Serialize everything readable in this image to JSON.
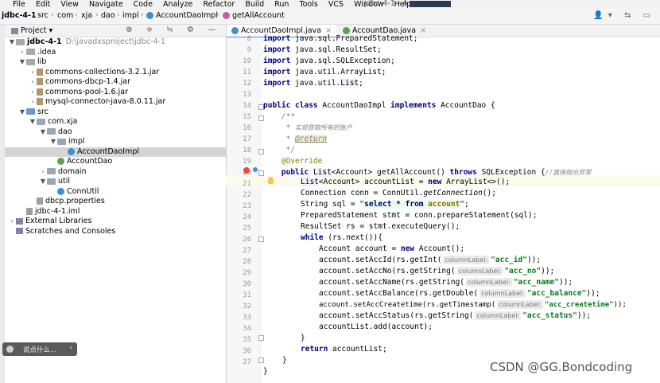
{
  "menu": [
    "File",
    "Edit",
    "View",
    "Navigate",
    "Code",
    "Analyze",
    "Refactor",
    "Build",
    "Run",
    "Tools",
    "VCS",
    "Window",
    "Help"
  ],
  "window_title": "jdbc-4-1 - A",
  "breadcrumbs": [
    "jdbc-4-1",
    "src",
    "com",
    "xja",
    "dao",
    "impl",
    "AccountDaoImpl",
    "getAllAccount"
  ],
  "project_panel": {
    "title": "Project",
    "tree": [
      {
        "label": "jdbc-4-1",
        "hint": "D:\\javadxsproject\\jdbc-4-1",
        "icon": "folder-icon",
        "arrow": "▼",
        "depth": 0,
        "bold": true
      },
      {
        "label": ".idea",
        "icon": "folder-icon",
        "arrow": "›",
        "depth": 1
      },
      {
        "label": "lib",
        "icon": "folder-icon",
        "arrow": "▼",
        "depth": 1
      },
      {
        "label": "commons-collections-3.2.1.jar",
        "icon": "jar-icon",
        "arrow": "›",
        "depth": 2
      },
      {
        "label": "commons-dbcp-1.4.jar",
        "icon": "jar-icon",
        "arrow": "›",
        "depth": 2
      },
      {
        "label": "commons-pool-1.6.jar",
        "icon": "jar-icon",
        "arrow": "›",
        "depth": 2
      },
      {
        "label": "mysql-connector-java-8.0.11.jar",
        "icon": "jar-icon",
        "arrow": "›",
        "depth": 2
      },
      {
        "label": "src",
        "icon": "source-folder-icon",
        "arrow": "▼",
        "depth": 1
      },
      {
        "label": "com.xja",
        "icon": "package-icon",
        "arrow": "▼",
        "depth": 2
      },
      {
        "label": "dao",
        "icon": "package-icon",
        "arrow": "▼",
        "depth": 3
      },
      {
        "label": "impl",
        "icon": "package-icon",
        "arrow": "▼",
        "depth": 4
      },
      {
        "label": "AccountDaoImpl",
        "icon": "class-icon",
        "arrow": "",
        "depth": 5,
        "selected": true
      },
      {
        "label": "AccountDao",
        "icon": "interface-icon",
        "arrow": "",
        "depth": 4
      },
      {
        "label": "domain",
        "icon": "package-icon",
        "arrow": "›",
        "depth": 3
      },
      {
        "label": "util",
        "icon": "package-icon",
        "arrow": "▼",
        "depth": 3
      },
      {
        "label": "ConnUtil",
        "icon": "class-icon",
        "arrow": "",
        "depth": 4
      },
      {
        "label": "dbcp.properties",
        "icon": "properties-file-icon",
        "arrow": "",
        "depth": 2
      },
      {
        "label": "jdbc-4-1.iml",
        "icon": "iml-file-icon",
        "arrow": "",
        "depth": 1
      },
      {
        "label": "External Libraries",
        "icon": "libraries-icon",
        "arrow": "›",
        "depth": 0
      },
      {
        "label": "Scratches and Consoles",
        "icon": "scratches-icon",
        "arrow": "",
        "depth": 0
      }
    ]
  },
  "popup": {
    "text": "说点什么..."
  },
  "tabs": [
    {
      "label": "AccountDaoImpl.java",
      "active": true,
      "icon": "class-icon"
    },
    {
      "label": "AccountDao.java",
      "active": false,
      "icon": "interface-icon"
    }
  ],
  "editor": {
    "line_numbers": [
      "8",
      "9",
      "10",
      "11",
      "12",
      "13",
      "14",
      "15",
      "16",
      "17",
      "18",
      "19",
      "20",
      "21",
      "22",
      "23",
      "24",
      "25",
      "26",
      "27",
      "28",
      "29",
      "30",
      "31",
      "32",
      "33",
      "34",
      "35",
      "36",
      "37"
    ],
    "code": {
      "l8_kw": "import",
      "l8_rest": " java.sql.PreparedStatement;",
      "l9_kw": "import",
      "l9_rest": " java.sql.ResultSet;",
      "l10_kw": "import",
      "l10_rest": " java.sql.SQLException;",
      "l11_kw": "import",
      "l11_rest": " java.util.ArrayList;",
      "l12_kw": "import",
      "l12_rest": " java.util.",
      "l12_type": "List",
      ";": ";",
      "l14_kw1": "public class",
      "l14_name": " AccountDaoImpl ",
      "l14_kw2": "implements",
      "l14_rest": " AccountDao {",
      "l15": "    /**",
      "l16_star": "     * ",
      "l16_cn": "实现获取所有的账户",
      "l17_star": "     * ",
      "l17_tag": "@return",
      "l18": "     */",
      "l19_ann": "    @Override",
      "l20_kw": "    public ",
      "l20_type": "List",
      "l20_rest": "<Account> getAllAccount() ",
      "l20_kw2": "throws",
      "l20_rest2": " SQLException {",
      "l20_cm": "//直接抛出异常",
      "l21_type": "List",
      "l21_rest": "<Account> accountList = ",
      "l21_kw": "new",
      "l21_rest2": " ArrayList<>();",
      "l22_rest": "Connection conn = ConnUtil.",
      "l22_it": "getConnection",
      "l22_end": "();",
      "l23_rest": "String sql = ",
      "l23_q1": "\"",
      "l23_s1": "select",
      "l23_sp1": " ",
      "l23_star": "*",
      "l23_sp2": " ",
      "l23_s2": "from",
      "l23_sp3": " ",
      "l23_t": "account",
      "l23_q2": "\"",
      "l24": "PreparedStatement stmt = conn.prepareStatement(sql);",
      "l25": "ResultSet rs = stmt.executeQuery();",
      "l26_kw": "while",
      "l26_rest": " (rs.next()){",
      "l27_rest": "Account account = ",
      "l27_kw": "new",
      "l27_rest2": " Account();",
      "l28_a": "account.setAccId(rs.getInt(",
      "l28_h": "columnLabel:",
      "l28_s": "\"acc_id\"",
      "l28_e": "));",
      "l29_a": "account.setAccNo(rs.getString(",
      "l29_h": "columnLabel:",
      "l29_s": "\"acc_no\"",
      "l29_e": "));",
      "l30_a": "account.setAccName(rs.getString(",
      "l30_h": "columnLabel:",
      "l30_s": "\"acc_name\"",
      "l30_e": "));",
      "l31_a": "account.setAccBalance(rs.getDouble(",
      "l31_h": "columnLabel:",
      "l31_s": "\"acc_balance\"",
      "l31_e": "));",
      "l32_a": "account.setAccCreatetime(rs.getTimestamp(",
      "l32_h": "columnLabel:",
      "l32_s": "\"acc_createtime\"",
      "l32_e": "));",
      "l33_a": "account.setAccStatus(rs.getString(",
      "l33_h": "columnLabel:",
      "l33_s": "\"acc_status\"",
      "l33_e": "));",
      "l34": "accountList.add(account);",
      "l35": "}",
      "l36_kw": "return",
      "l36_rest": " accountList;",
      "l37": "}",
      "l38": "}"
    }
  },
  "watermark": "CSDN @GG.Bondcoding"
}
